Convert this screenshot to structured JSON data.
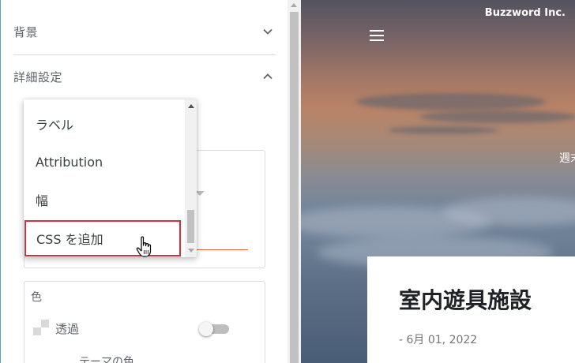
{
  "panel": {
    "sections": [
      {
        "label": "背景",
        "expanded": false
      },
      {
        "label": "詳細設定",
        "expanded": true
      }
    ],
    "color": {
      "label": "色",
      "transparent_label": "透過",
      "transparent_on": false,
      "theme_color_label": "テーマの色"
    }
  },
  "dropdown": {
    "options": [
      "ラベル",
      "Attribution",
      "幅",
      "CSS を追加"
    ],
    "selected": "CSS を追加",
    "highlight_color": "#d32f3f"
  },
  "preview": {
    "brand": "Buzzword Inc.",
    "side_text": "週末",
    "post": {
      "title": "室内遊具施設",
      "date": "- 6月 01, 2022"
    }
  }
}
